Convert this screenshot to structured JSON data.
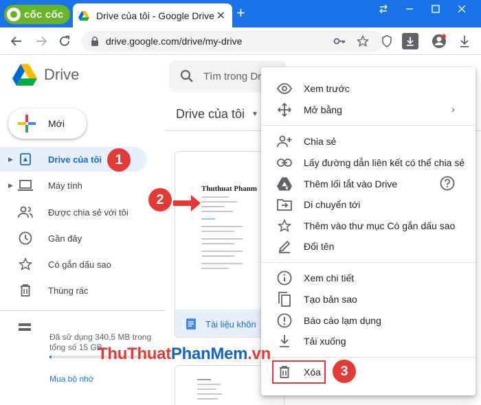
{
  "browser": {
    "brand": "cốc cốc",
    "tab_title": "Drive của tôi - Google Drive",
    "tab_close": "✕",
    "new_tab": "+",
    "url": "drive.google.com/drive/my-drive"
  },
  "drive": {
    "app_name": "Drive",
    "search_placeholder": "Tìm trong Drive",
    "new_button": "Mới",
    "nav": [
      {
        "label": "Drive của tôi",
        "icon": "my-drive-icon"
      },
      {
        "label": "Máy tính",
        "icon": "computer-icon"
      },
      {
        "label": "Được chia sẻ với tôi",
        "icon": "shared-icon"
      },
      {
        "label": "Gần đây",
        "icon": "clock-icon"
      },
      {
        "label": "Có gắn dấu sao",
        "icon": "star-icon"
      },
      {
        "label": "Thùng rác",
        "icon": "trash-icon"
      }
    ],
    "storage_text": "Đã sử dụng 340,5 MB trong tổng số 15 GB",
    "storage_fraction": 0.023,
    "buy_storage": "Mua bộ nhớ",
    "breadcrumb": "Drive của tôi",
    "file": {
      "preview_name": "Thuthuat Phanm",
      "card_name": "Tài liệu khôn"
    }
  },
  "context_menu": {
    "groups": [
      [
        {
          "label": "Xem trước",
          "icon": "eye-icon"
        },
        {
          "label": "Mở bằng",
          "icon": "move-arrows-icon",
          "submenu": true
        }
      ],
      [
        {
          "label": "Chia sẻ",
          "icon": "person-add-icon"
        },
        {
          "label": "Lấy đường dẫn liên kết có thể chia sẻ",
          "icon": "link-icon"
        },
        {
          "label": "Thêm lối tắt vào Drive",
          "icon": "drive-shortcut-icon",
          "help": true
        },
        {
          "label": "Di chuyển tới",
          "icon": "move-folder-icon"
        },
        {
          "label": "Thêm vào thư mục Có gắn dấu sao",
          "icon": "star-outline-icon"
        },
        {
          "label": "Đổi tên",
          "icon": "pencil-icon"
        }
      ],
      [
        {
          "label": "Xem chi tiết",
          "icon": "info-icon"
        },
        {
          "label": "Tạo bản sao",
          "icon": "copy-icon"
        },
        {
          "label": "Báo cáo lạm dụng",
          "icon": "report-icon"
        },
        {
          "label": "Tải xuống",
          "icon": "download-icon"
        }
      ],
      [
        {
          "label": "Xóa",
          "icon": "trash-icon"
        }
      ]
    ]
  },
  "annotations": {
    "step1": "1",
    "step2": "2",
    "step3": "3",
    "watermark_part1": "ThuThuat",
    "watermark_part2": "PhanMem",
    "watermark_part3": ".vn",
    "accent": "#e53935"
  }
}
